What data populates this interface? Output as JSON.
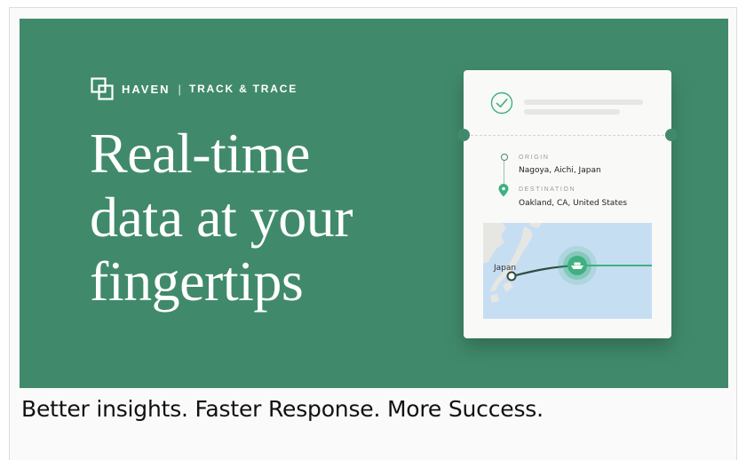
{
  "banner": {
    "brand_name": "HAVEN",
    "brand_separator": "|",
    "brand_product": "TRACK & TRACE",
    "headline_lines": [
      "Real-time",
      "data at your",
      "fingertips"
    ],
    "background_color": "#408a6b"
  },
  "ticket": {
    "status_icon": "check-circle-icon",
    "origin_label": "ORIGIN",
    "origin_city": "Nagoya, Aichi, Japan",
    "destination_label": "DESTINATION",
    "destination_city": "Oakland, CA, United States",
    "map_label": "Japan",
    "vessel_icon": "ship-icon",
    "accent_color": "#3fb07f"
  },
  "tagline": "Better insights. Faster Response. More Success."
}
